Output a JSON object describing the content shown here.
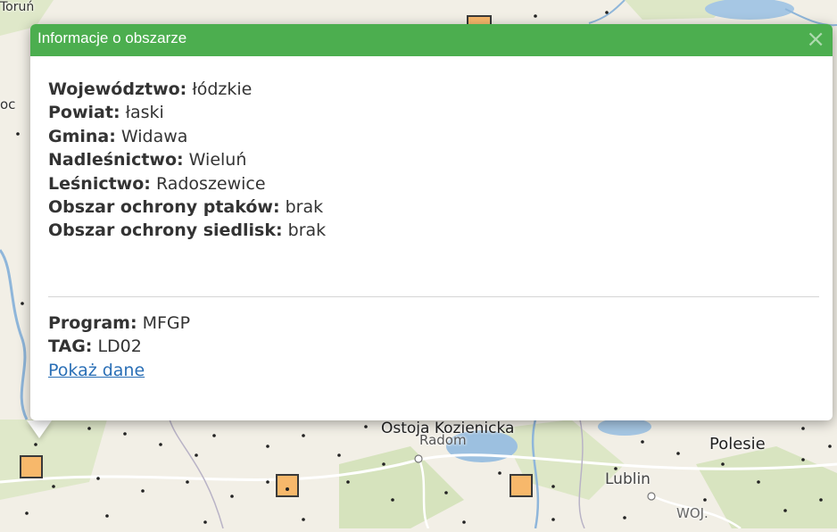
{
  "map": {
    "labels": {
      "top_left": "Toruń",
      "left_edge": "oc",
      "ostoja": "Ostoja Kozienicka",
      "radom": "Radom",
      "polesie": "Polesie",
      "lublin": "Lublin",
      "woj": "WOJ."
    }
  },
  "popup": {
    "title": "Informacje o obszarze",
    "close_glyph": "×",
    "fields": [
      {
        "label": "Województwo:",
        "value": "łódzkie"
      },
      {
        "label": "Powiat:",
        "value": "łaski"
      },
      {
        "label": "Gmina:",
        "value": "Widawa"
      },
      {
        "label": "Nadleśnictwo:",
        "value": "Wieluń"
      },
      {
        "label": "Leśnictwo:",
        "value": "Radoszewice"
      },
      {
        "label": "Obszar ochrony ptaków:",
        "value": "brak"
      },
      {
        "label": "Obszar ochrony siedlisk:",
        "value": "brak"
      }
    ],
    "program": {
      "label": "Program:",
      "value": "MFGP"
    },
    "tag": {
      "label": "TAG:",
      "value": "LD02"
    },
    "link": "Pokaż dane"
  },
  "colors": {
    "header": "#4cae4f",
    "marker_fill": "#f7b86b",
    "link": "#2a6fb6"
  }
}
